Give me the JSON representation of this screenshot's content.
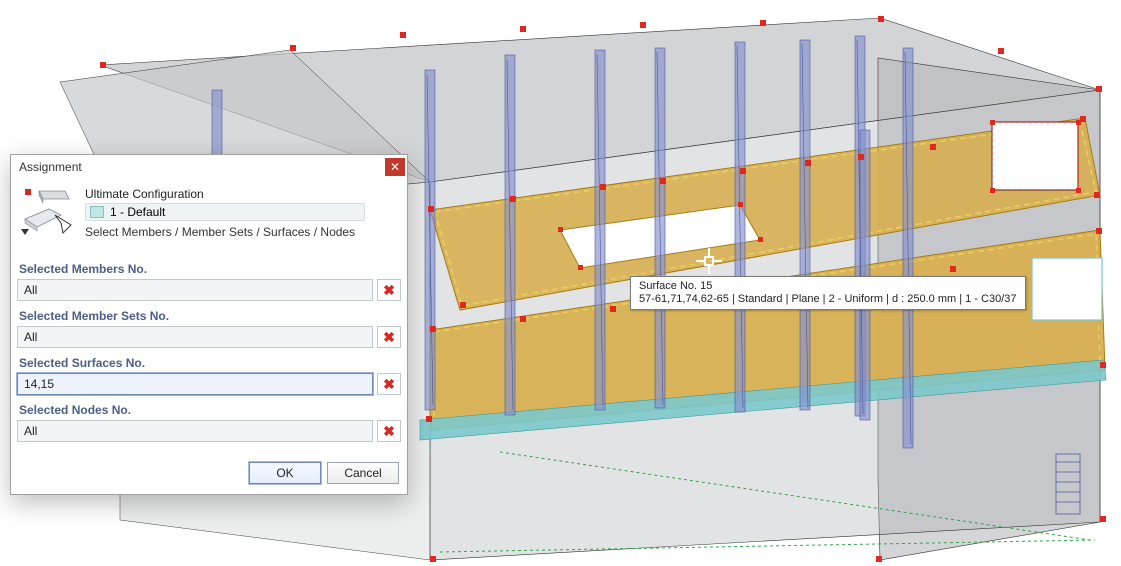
{
  "dialog": {
    "title": "Assignment",
    "header": {
      "config_label": "Ultimate Configuration",
      "default_label": "1 - Default",
      "select_hint": "Select Members / Member Sets / Surfaces / Nodes"
    },
    "sections": {
      "members": {
        "label": "Selected Members No.",
        "value": "All"
      },
      "membersets": {
        "label": "Selected Member Sets No.",
        "value": "All"
      },
      "surfaces": {
        "label": "Selected Surfaces No.",
        "value": "14,15"
      },
      "nodes": {
        "label": "Selected Nodes No.",
        "value": "All"
      }
    },
    "buttons": {
      "ok": "OK",
      "cancel": "Cancel"
    },
    "clear_glyph": "✖"
  },
  "tooltip": {
    "line1": "Surface No. 15",
    "line2": "57-61,71,74,62-65 | Standard | Plane | 2 - Uniform | d : 250.0 mm | 1 - C30/37"
  },
  "colors": {
    "highlight_fill": "#d8ad4a",
    "highlight_stroke": "#c58d0c",
    "node_red": "#e0281e",
    "wall_grey": "#b5b8ba",
    "wall_darker": "#9ea1a4",
    "floor_edge": "#6dbfc4",
    "rebar_blue": "#6f80c2",
    "dashed_yellow": "#e0c44c"
  }
}
